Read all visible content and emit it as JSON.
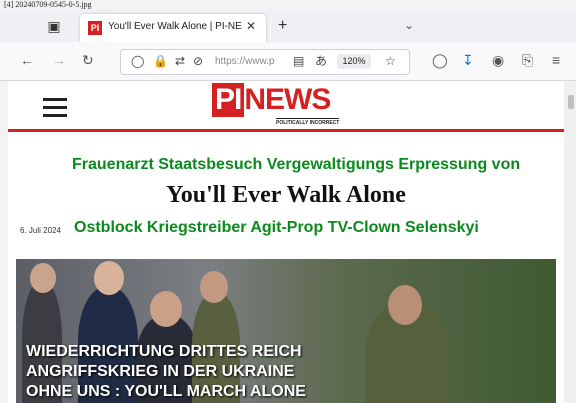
{
  "caption": "[4] 20240709-0545-0-5.jpg",
  "browser": {
    "tab_title": "You'll Ever Walk Alone | PI-NEWS",
    "tab_favicon": "PI",
    "url_text": "https://www.p",
    "zoom": "120%",
    "icons": [
      "tab-list-icon",
      "close-icon",
      "plus-icon",
      "chevron-down-icon",
      "back-icon",
      "forward-icon",
      "reload-icon",
      "shield-icon",
      "lock-icon",
      "permissions-icon",
      "reader-icon",
      "translate-icon",
      "star-icon",
      "pocket-icon",
      "download-icon",
      "account-icon",
      "extensions-icon",
      "menu-icon"
    ]
  },
  "site": {
    "logo_pi": "PI",
    "logo_news": "NEWS",
    "logo_tagline": "POLITICALLY INCORRECT",
    "accent_color": "#d52121",
    "keyword_color": "#0b8a1e"
  },
  "article": {
    "keywords_line1": "Frauenarzt Staatsbesuch Vergewaltigungs Erpressung von",
    "headline": "You'll Ever Walk Alone",
    "date": "6. Juli 2024",
    "keywords_line2": "Ostblock Kriegstreiber  Agit-Prop TV-Clown Selenskyi",
    "image_text": [
      "WIEDERRICHTUNG DRITTES REICH",
      "ANGRIFFSKRIEG IN DER UKRAINE",
      "OHNE UNS : YOU'LL MARCH ALONE"
    ]
  }
}
